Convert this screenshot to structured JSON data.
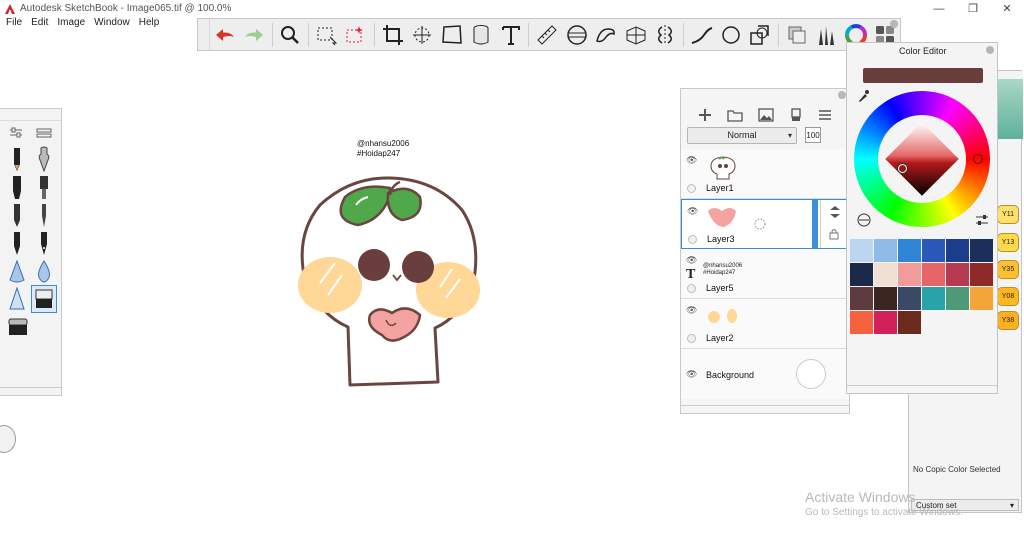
{
  "window": {
    "title": "Autodesk SketchBook - Image065.tif @ 100.0%",
    "controls": [
      "—",
      "❐",
      "✕"
    ]
  },
  "menu": [
    "File",
    "Edit",
    "Image",
    "Window",
    "Help"
  ],
  "toolbar": {
    "tools": [
      "undo-icon",
      "redo-icon",
      "zoom-icon",
      "select-icon",
      "magic-wand-icon",
      "crop-icon",
      "transform-icon",
      "distort-icon",
      "fill-icon",
      "text-icon",
      "ruler-icon",
      "ellipse-guide-icon",
      "french-curve-icon",
      "perspective-icon",
      "symmetry-icon",
      "stroke-icon",
      "shape-icon",
      "copy-layer-icon",
      "brush-library-icon",
      "copic-icon",
      "color-wheel-icon",
      "swatch-grid-icon"
    ]
  },
  "canvas": {
    "caption_line1": "@nhansu2006",
    "caption_line2": "#Hoidap247"
  },
  "layers_panel": {
    "blend_mode": "Normal",
    "opacity": "100",
    "layers": [
      {
        "name": "Layer1",
        "active": false
      },
      {
        "name": "Layer3",
        "active": true
      },
      {
        "name": "Layer5",
        "active": false,
        "text_line1": "@nhansu2006",
        "text_line2": "#Hoidap247"
      },
      {
        "name": "Layer2",
        "active": false
      },
      {
        "name": "Background",
        "active": false
      }
    ]
  },
  "color_editor": {
    "title": "Color Editor",
    "current_color": "#6b3e3e",
    "swatches": [
      "#bcd6f0",
      "#8fbbe9",
      "#2f86d6",
      "#2a59b8",
      "#1a3d8c",
      "#1b2f5a",
      "#1c2a4a",
      "#f0e0d4",
      "#f19c9a",
      "#e56568",
      "#b63a52",
      "#8e2a2a",
      "#5e3b3e",
      "#3b2621",
      "#3a4a66",
      "#29a2a9",
      "#4e9a78",
      "#f4a53a",
      "#f5603d",
      "#d2215a",
      "#6a2a1e"
    ]
  },
  "copic_panel": {
    "chips": [
      "Y11",
      "Y13",
      "Y35",
      "Y08",
      "Y38"
    ],
    "no_selection": "No Copic Color Selected",
    "dropdown": "Custom set"
  },
  "watermark": {
    "line1": "Activate Windows",
    "line2": "Go to Settings to activate Windows."
  }
}
